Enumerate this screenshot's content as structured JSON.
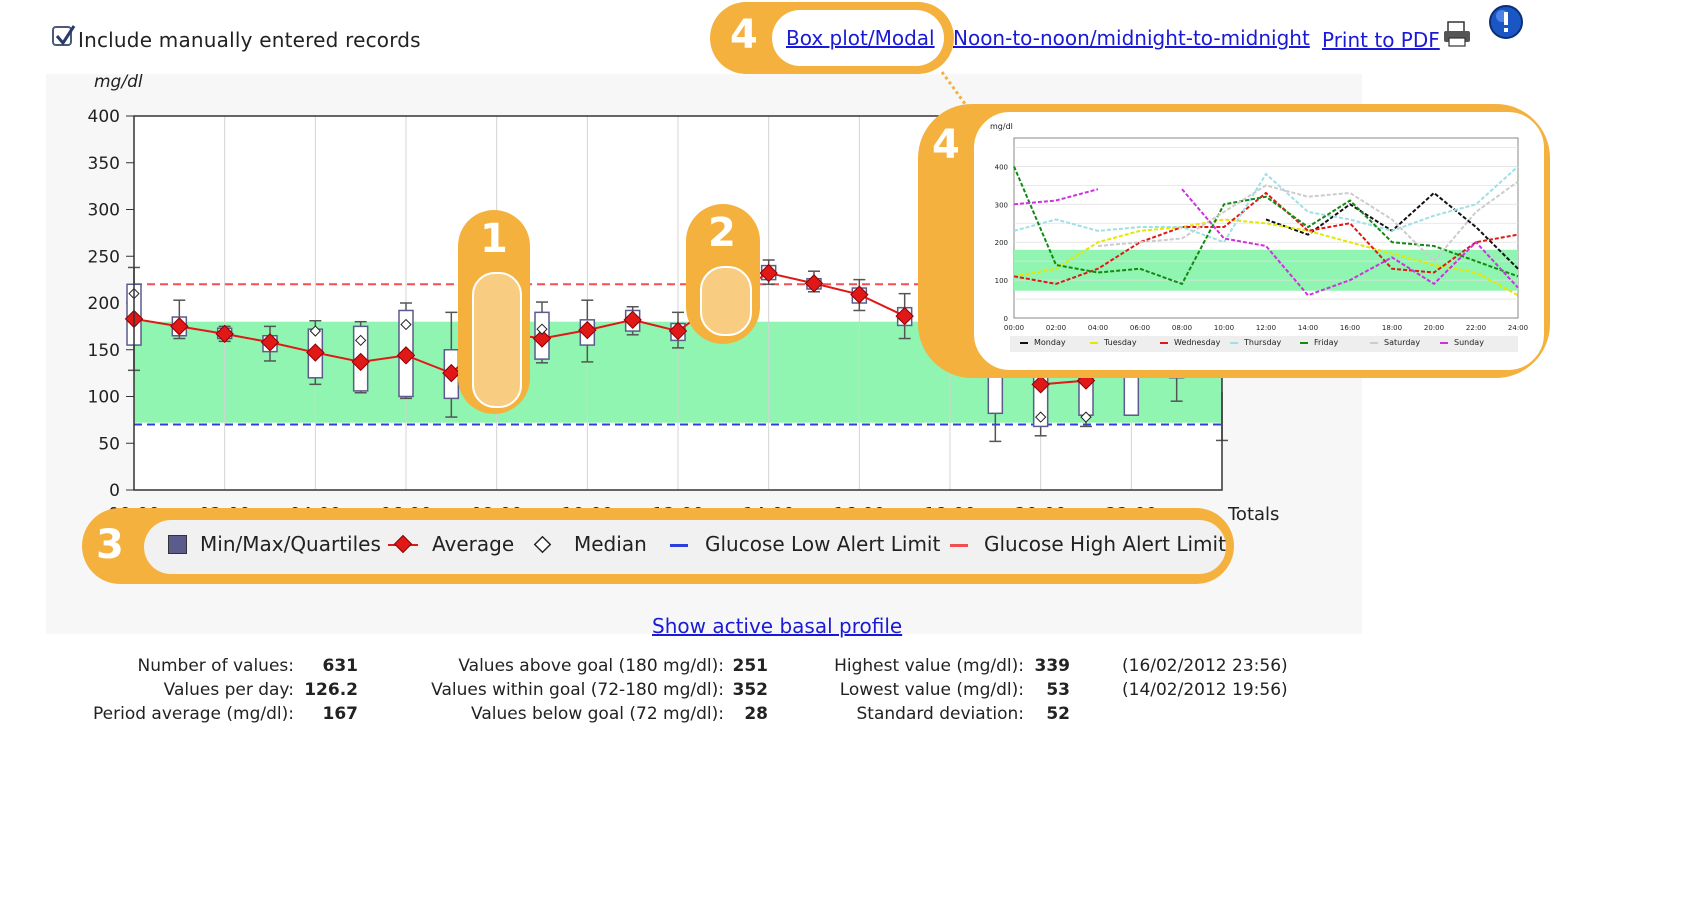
{
  "options": {
    "include_manual_label": "Include manually entered records",
    "include_manual_checked": true
  },
  "links": {
    "box_plot": "Box plot/Modal",
    "noon": "Noon-to-noon/midnight-to-midnight",
    "print_pdf": "Print to PDF",
    "show_basal": "Show active basal profile"
  },
  "icons": {
    "printer": "printer-icon",
    "info": "info-icon",
    "checkbox": "check-icon"
  },
  "badges": [
    "1",
    "2",
    "3",
    "4",
    "4"
  ],
  "colors": {
    "accent": "#f4b13e",
    "goal_band": "#8ff5b0",
    "high_limit": "#f25050",
    "low_limit": "#2a3fdc",
    "average": "#e01818",
    "box": "#5b5b8c",
    "link": "#1a1ad6"
  },
  "chart_data": [
    {
      "type": "box",
      "ylabel": "mg/dl",
      "ylim": [
        0,
        400
      ],
      "yticks": [
        "400",
        "350",
        "300",
        "250",
        "200",
        "150",
        "100",
        "50",
        "0"
      ],
      "xticks": [
        "00:00",
        "02:00",
        "04:00",
        "06:00",
        "08:00",
        "10:00",
        "12:00",
        "14:00",
        "16:00",
        "18:00",
        "20:00",
        "22:00",
        "Totals"
      ],
      "goal_range": [
        72,
        180
      ],
      "high_alert_limit": 220,
      "low_alert_limit": 70,
      "hours": [
        0,
        1,
        2,
        3,
        4,
        5,
        6,
        7,
        8,
        9,
        10,
        11,
        12,
        13,
        14,
        15,
        16,
        17,
        19,
        20,
        21,
        22,
        23
      ],
      "average": [
        183,
        175,
        167,
        158,
        147,
        137,
        144,
        125,
        169,
        162,
        171,
        182,
        170,
        205,
        232,
        221,
        209,
        186,
        null,
        113,
        117,
        null,
        null
      ],
      "median": [
        210,
        null,
        null,
        null,
        170,
        160,
        177,
        null,
        null,
        172,
        null,
        null,
        null,
        null,
        null,
        null,
        null,
        null,
        null,
        78,
        78,
        null,
        null
      ],
      "q1": [
        155,
        165,
        162,
        148,
        120,
        106,
        100,
        98,
        160,
        140,
        155,
        170,
        160,
        180,
        225,
        215,
        200,
        176,
        82,
        68,
        80,
        80,
        120
      ],
      "q3": [
        220,
        185,
        173,
        165,
        172,
        175,
        192,
        150,
        185,
        190,
        182,
        192,
        178,
        228,
        240,
        226,
        216,
        195,
        150,
        150,
        150,
        150,
        150
      ],
      "min": [
        128,
        162,
        159,
        138,
        113,
        104,
        98,
        78,
        135,
        136,
        137,
        166,
        152,
        178,
        220,
        212,
        192,
        162,
        52,
        58,
        68,
        80,
        95
      ],
      "max": [
        238,
        203,
        175,
        175,
        181,
        180,
        200,
        190,
        205,
        201,
        203,
        196,
        190,
        235,
        246,
        234,
        225,
        210,
        150,
        150,
        150,
        150,
        150
      ],
      "totals_min": 53,
      "legend": [
        "Min/Max/Quartiles",
        "Average",
        "Median",
        "Glucose Low Alert Limit",
        "Glucose High Alert Limit"
      ]
    },
    {
      "type": "line",
      "ylabel": "mg/dl",
      "ylim": [
        0,
        400
      ],
      "yticks": [
        "400",
        "300",
        "200",
        "100",
        "0"
      ],
      "xticks": [
        "00:00",
        "02:00",
        "04:00",
        "06:00",
        "08:00",
        "10:00",
        "12:00",
        "14:00",
        "16:00",
        "18:00",
        "20:00",
        "22:00",
        "24:00"
      ],
      "goal_range": [
        72,
        180
      ],
      "x": [
        0,
        2,
        4,
        6,
        8,
        10,
        12,
        14,
        16,
        18,
        20,
        22,
        24
      ],
      "series": [
        {
          "name": "Monday",
          "color": "#111111",
          "values": [
            null,
            null,
            null,
            null,
            null,
            null,
            260,
            220,
            300,
            230,
            330,
            240,
            130
          ]
        },
        {
          "name": "Tuesday",
          "color": "#e6e600",
          "values": [
            110,
            130,
            200,
            230,
            240,
            260,
            250,
            230,
            200,
            170,
            140,
            120,
            60
          ]
        },
        {
          "name": "Wednesday",
          "color": "#e01818",
          "values": [
            110,
            90,
            130,
            200,
            240,
            240,
            330,
            230,
            250,
            130,
            120,
            200,
            220
          ]
        },
        {
          "name": "Thursday",
          "color": "#9ee0e6",
          "values": [
            230,
            260,
            230,
            240,
            240,
            200,
            380,
            280,
            260,
            230,
            270,
            300,
            400
          ]
        },
        {
          "name": "Friday",
          "color": "#128a12",
          "values": [
            400,
            140,
            120,
            130,
            90,
            300,
            320,
            240,
            310,
            200,
            190,
            150,
            110
          ]
        },
        {
          "name": "Saturday",
          "color": "#cccccc",
          "values": [
            null,
            null,
            190,
            200,
            210,
            280,
            350,
            320,
            330,
            260,
            150,
            280,
            360
          ]
        },
        {
          "name": "Sunday",
          "color": "#cc33dd",
          "values": [
            300,
            310,
            340,
            null,
            340,
            210,
            190,
            60,
            100,
            160,
            90,
            200,
            80
          ]
        }
      ]
    }
  ],
  "stats": {
    "col1": [
      {
        "label": "Number of values:",
        "value": "631"
      },
      {
        "label": "Values per day:",
        "value": "126.2"
      },
      {
        "label": "Period average (mg/dl):",
        "value": "167"
      }
    ],
    "col2": [
      {
        "label": "Values above goal (180 mg/dl):",
        "value": "251"
      },
      {
        "label": "Values within goal (72-180 mg/dl):",
        "value": "352"
      },
      {
        "label": "Values below goal (72 mg/dl):",
        "value": "28"
      }
    ],
    "col3": [
      {
        "label": "Highest value (mg/dl):",
        "value": "339",
        "extra": "(16/02/2012 23:56)"
      },
      {
        "label": "Lowest value (mg/dl):",
        "value": "53",
        "extra": "(14/02/2012 19:56)"
      },
      {
        "label": "Standard deviation:",
        "value": "52",
        "extra": ""
      }
    ]
  }
}
